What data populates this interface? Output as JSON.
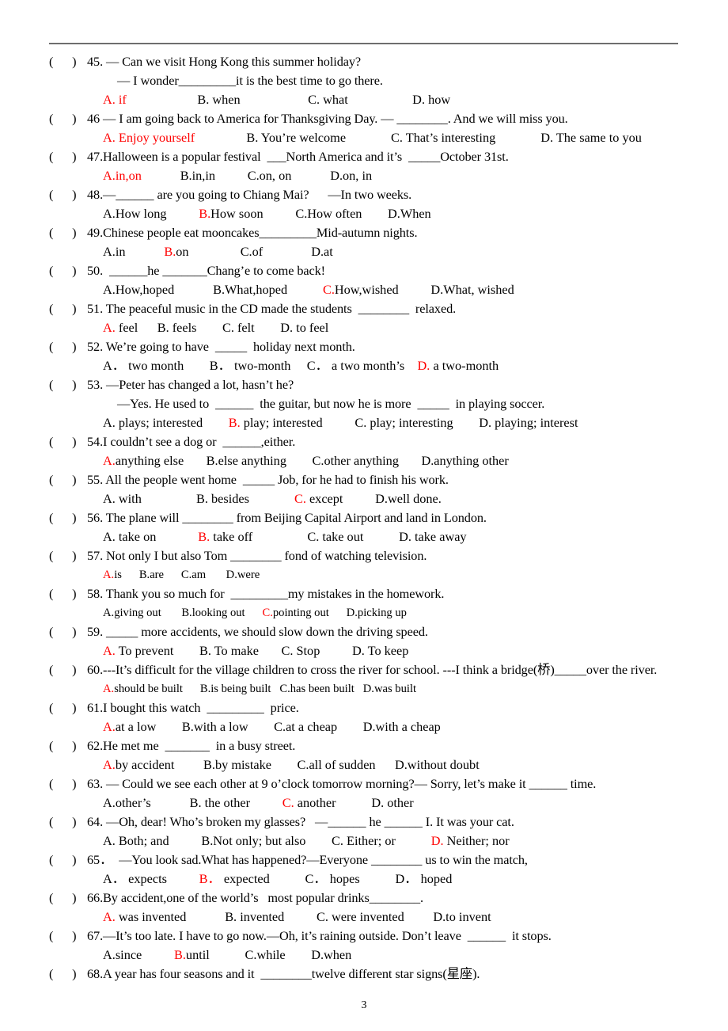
{
  "document": {
    "page_number": "3",
    "answer_color": "#ff0000",
    "rule_color": "#6e6e6e"
  },
  "questions": [
    {
      "marker": "(      )",
      "lines": [
        "45. — Can we visit Hong Kong this summer holiday?",
        "— I wonder_________it is the best time to go there."
      ],
      "options_line": "A. if\t\tB. when\t\tC. what\t\tD. how",
      "options_raw": "A. if                      B. when                     C. what                    D. how",
      "answer_letter": "A",
      "answer_text": "A. if",
      "answer_full_red": true,
      "options": [
        "A. if",
        "B. when",
        "C. what",
        "D. how"
      ]
    },
    {
      "marker": "(      )",
      "lines": [
        "46 — I am going back to America for Thanksgiving Day. — ________. And we will miss you."
      ],
      "options_raw": "A. Enjoy yourself                B. You’re welcome              C. That’s interesting              D. The same to you",
      "answer_letter": "A",
      "answer_text": "A. Enjoy yourself",
      "answer_full_red": true,
      "options": [
        "A. Enjoy yourself",
        "B. You’re welcome",
        "C. That’s interesting",
        "D. The same to you"
      ]
    },
    {
      "marker": "(      )",
      "lines": [
        "47.Halloween is a popular festival  ___North America and it’s  _____October 31st."
      ],
      "options_raw": "A.in,on            B.in,in          C.on, on            D.on, in",
      "answer_letter": "A",
      "answer_text": "A.in,on",
      "answer_full_red": true,
      "options": [
        "A.in,on",
        "B.in,in",
        "C.on, on",
        "D.on, in"
      ]
    },
    {
      "marker": "(      )",
      "lines": [
        "48.—______ are you going to Chiang Mai?      —In two weeks."
      ],
      "options_raw": "A.How long          B.How soon          C.How often        D.When",
      "answer_letter": "B",
      "answer_text": "B.How soon",
      "answer_full_red": false,
      "options": [
        "A.How long",
        "B.How soon",
        "C.How often",
        "D.When"
      ]
    },
    {
      "marker": "(      )",
      "lines": [
        "49.Chinese people eat mooncakes_________Mid-autumn nights."
      ],
      "options_raw": "A.in            B.on                C.of               D.at",
      "answer_letter": "B",
      "answer_text": "B.on",
      "answer_full_red": false,
      "options": [
        "A.in",
        "B.on",
        "C.of",
        "D.at"
      ]
    },
    {
      "marker": "(      )",
      "lines": [
        "50.  ______he _______Chang’e to come back!"
      ],
      "options_raw": "A.How,hoped            B.What,hoped           C.How,wished          D.What, wished",
      "answer_letter": "C",
      "answer_text": "C.How,wished",
      "answer_full_red": false,
      "options": [
        "A.How,hoped",
        "B.What,hoped",
        "C.How,wished",
        "D.What, wished"
      ]
    },
    {
      "marker": "(      )",
      "lines": [
        "51. The peaceful music in the CD made the students  ________  relaxed."
      ],
      "options_raw": "A. feel      B. feels        C. felt        D. to feel",
      "answer_letter": "A",
      "answer_text": "A. feel",
      "answer_full_red": false,
      "options": [
        "A. feel",
        "B. feels",
        "C. felt",
        "D. to feel"
      ]
    },
    {
      "marker": "(      )",
      "lines": [
        "52. We’re going to have  _____  holiday next month."
      ],
      "options_raw": "A． two month        B． two-month     C． a two month’s    D. a two-month",
      "answer_letter": "D",
      "answer_text": "D. a two-month",
      "answer_full_red": false,
      "options": [
        "A． two month",
        "B． two-month",
        "C． a two month’s",
        "D. a two-month"
      ]
    },
    {
      "marker": "(      )",
      "lines": [
        "53. —Peter has changed a lot, hasn’t he?",
        "—Yes. He used to  ______  the guitar, but now he is more  _____  in playing soccer."
      ],
      "options_raw": "A. plays; interested        B. play; interested          C. play; interesting        D. playing; interest",
      "answer_letter": "B",
      "answer_text": "B. play; interested",
      "answer_full_red": false,
      "options": [
        "A. plays; interested",
        "B. play; interested",
        "C. play; interesting",
        "D. playing; interest"
      ]
    },
    {
      "marker": "(      )",
      "lines": [
        "54.I couldn’t see a dog or  ______,either."
      ],
      "options_raw": "A.anything else       B.else anything        C.other anything       D.anything other",
      "answer_letter": "A",
      "answer_text": "A.anything else",
      "answer_full_red": false,
      "options": [
        "A.anything else",
        "B.else anything",
        "C.other anything",
        "D.anything other"
      ]
    },
    {
      "marker": "(      )",
      "lines": [
        "55. All the people went home  _____ Job, for he had to finish his work."
      ],
      "options_raw": "A. with                 B. besides              C. except          D.well done.",
      "answer_letter": "C",
      "answer_text": "C. except",
      "answer_full_red": false,
      "options": [
        "A. with",
        "B. besides",
        "C. except",
        "D.well done."
      ]
    },
    {
      "marker": "(      )",
      "lines": [
        "56. The plane will ________ from Beijing Capital Airport and land in London."
      ],
      "options_raw": "A. take on             B. take off                 C. take out           D. take away",
      "answer_letter": "B",
      "answer_text": "B. take off",
      "answer_full_red": false,
      "options": [
        "A. take on",
        "B. take off",
        "C. take out",
        "D. take away"
      ]
    },
    {
      "marker": "(      )",
      "lines": [
        "57. Not only I but also Tom ________ fond of watching television."
      ],
      "options_raw": "A.is      B.are      C.am       D.were",
      "answer_letter": "A",
      "answer_text": "A.is",
      "answer_full_red": false,
      "small": true,
      "options": [
        "A.is",
        "B.are",
        "C.am",
        "D.were"
      ]
    },
    {
      "marker": "(      )",
      "lines": [
        "58. Thank you so much for  _________my mistakes in the homework."
      ],
      "options_raw": "A.giving out       B.looking out      C.pointing out      D.picking up",
      "answer_letter": "C",
      "answer_text": "C.pointing out",
      "answer_full_red": false,
      "small": true,
      "options": [
        "A.giving out",
        "B.looking out",
        "C.pointing out",
        "D.picking up"
      ]
    },
    {
      "marker": "(      )",
      "lines": [
        "59. _____ more accidents, we should slow down the driving speed."
      ],
      "options_raw": "A. To prevent        B. To make       C. Stop          D. To keep",
      "answer_letter": "A",
      "answer_text": "A. To prevent",
      "answer_full_red": false,
      "options": [
        "A. To prevent",
        "B. To make",
        "C. Stop",
        "D. To keep"
      ]
    },
    {
      "marker": "(      )",
      "lines": [
        "60.---It’s difficult for the village children to cross the river for school. ---I think a bridge(桥)_____over the river."
      ],
      "options_raw": "A.should be built      B.is being built   C.has been built   D.was built",
      "answer_letter": "A",
      "answer_text": "A.should be built",
      "answer_full_red": false,
      "small": true,
      "options": [
        "A.should be built",
        "B.is being built",
        "C.has been built",
        "D.was built"
      ]
    },
    {
      "marker": "(      )",
      "lines": [
        "61.I bought this watch  _________  price."
      ],
      "options_raw": "A.at a low        B.with a low        C.at a cheap        D.with a cheap",
      "answer_letter": "A",
      "answer_text": "A.at a low",
      "answer_full_red": false,
      "options": [
        "A.at a low",
        "B.with a low",
        "C.at a cheap",
        "D.with a cheap"
      ]
    },
    {
      "marker": "(      )",
      "lines": [
        "62.He met me  _______  in a busy street."
      ],
      "options_raw": "A.by accident         B.by mistake        C.all of sudden      D.without doubt",
      "answer_letter": "A",
      "answer_text": "A.by accident",
      "answer_full_red": false,
      "options": [
        "A.by accident",
        "B.by mistake",
        "C.all of sudden",
        "D.without doubt"
      ]
    },
    {
      "marker": "(      )",
      "lines": [
        "63. — Could we see each other at 9 o’clock tomorrow morning?— Sorry, let’s make it ______ time."
      ],
      "options_raw": "A.other’s            B. the other          C. another           D. other",
      "answer_letter": "C",
      "answer_text": "C. another",
      "answer_full_red": false,
      "options": [
        "A.other’s",
        "B. the other",
        "C. another",
        "D. other"
      ]
    },
    {
      "marker": "(      )",
      "lines": [
        "64. —Oh, dear! Who’s broken my glasses?   —______ he ______ I. It was your cat."
      ],
      "options_raw": "A. Both; and          B.Not only; but also        C. Either; or           D. Neither; nor",
      "answer_letter": "D",
      "answer_text": "D. Neither; nor",
      "answer_full_red": false,
      "options": [
        "A. Both; and",
        "B.Not only; but also",
        "C. Either; or",
        "D. Neither; nor"
      ]
    },
    {
      "marker": "(      )",
      "lines": [
        "65．  —You look sad.What has happened?—Everyone ________ us to win the match,"
      ],
      "options_raw": "A． expects          B． expected           C． hopes           D． hoped",
      "answer_letter": "B",
      "answer_text": "B． expected",
      "answer_full_red": false,
      "options": [
        "A． expects",
        "B． expected",
        "C． hopes",
        "D． hoped"
      ]
    },
    {
      "marker": "(      )",
      "lines": [
        "66.By accident,one of the world’s   most popular drinks________."
      ],
      "options_raw": "A. was invented            B. invented          C. were invented         D.to invent",
      "answer_letter": "A",
      "answer_text": "A. was invented",
      "answer_full_red": false,
      "options": [
        "A. was invented",
        "B. invented",
        "C. were invented",
        "D.to invent"
      ]
    },
    {
      "marker": "(      )",
      "lines": [
        "67.—It’s too late. I have to go now.—Oh, it’s raining outside. Don’t leave  ______  it stops."
      ],
      "options_raw": "A.since          B.until           C.while        D.when",
      "answer_letter": "B",
      "answer_text": "B.until",
      "answer_full_red": false,
      "options": [
        "A.since",
        "B.until",
        "C.while",
        "D.when"
      ]
    },
    {
      "marker": "(      )",
      "lines": [
        "68.A year has four seasons and it  ________twelve different star signs(星座)."
      ],
      "options_raw": "",
      "answer_letter": "",
      "answer_text": "",
      "answer_full_red": false,
      "options": []
    }
  ]
}
